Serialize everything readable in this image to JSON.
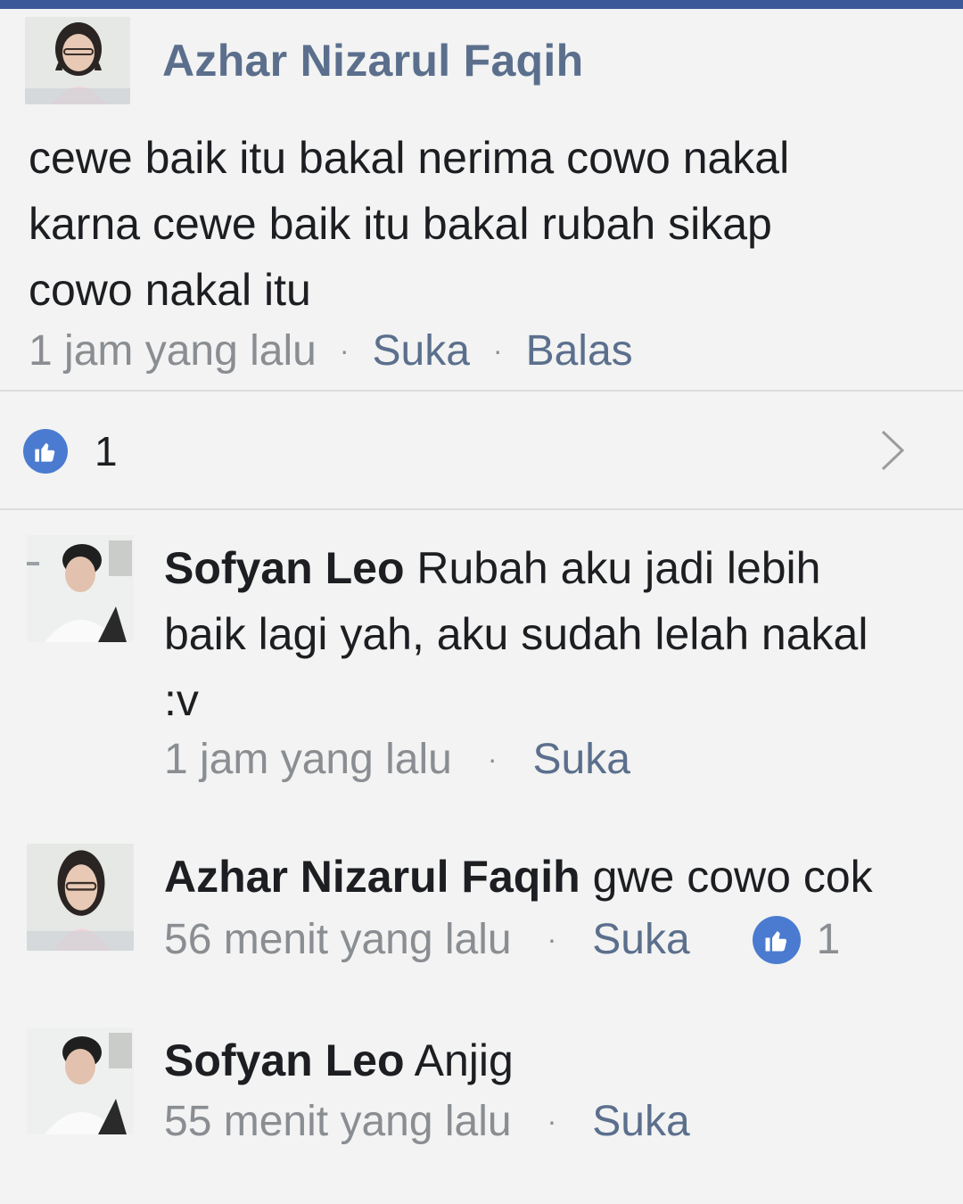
{
  "colors": {
    "top_bar": "#3b5998",
    "author_link": "#5b6f8d",
    "like_badge": "#4a7bd0",
    "meta_gray": "#8a8d91",
    "background": "#f2f3f2"
  },
  "post": {
    "author": "Azhar Nizarul Faqih",
    "avatar_icon": "profile-photo-girl",
    "body_lines": [
      "cewe baik itu bakal nerima cowo nakal",
      "karna cewe baik itu bakal rubah sikap",
      "cowo nakal itu"
    ],
    "time": "1 jam yang lalu",
    "like_label": "Suka",
    "reply_label": "Balas",
    "separator": "·"
  },
  "reactions": {
    "icon": "thumbs-up-icon",
    "count": "1",
    "chevron_icon": "chevron-right-icon"
  },
  "replies": [
    {
      "author": "Sofyan Leo",
      "avatar_icon": "profile-photo-boy",
      "text_line1": " Rubah aku jadi lebih",
      "text_line2": "baik lagi yah, aku sudah lelah nakal",
      "text_line3": ":v",
      "time": "1 jam yang lalu",
      "like_label": "Suka"
    },
    {
      "author": "Azhar Nizarul Faqih",
      "avatar_icon": "profile-photo-girl",
      "text_line1": " gwe cowo cok",
      "time": "56 menit yang lalu",
      "like_label": "Suka",
      "like_count": "1"
    },
    {
      "author": "Sofyan Leo",
      "avatar_icon": "profile-photo-boy",
      "text_line1": " Anjig",
      "time": "55 menit yang lalu",
      "like_label": "Suka"
    }
  ]
}
